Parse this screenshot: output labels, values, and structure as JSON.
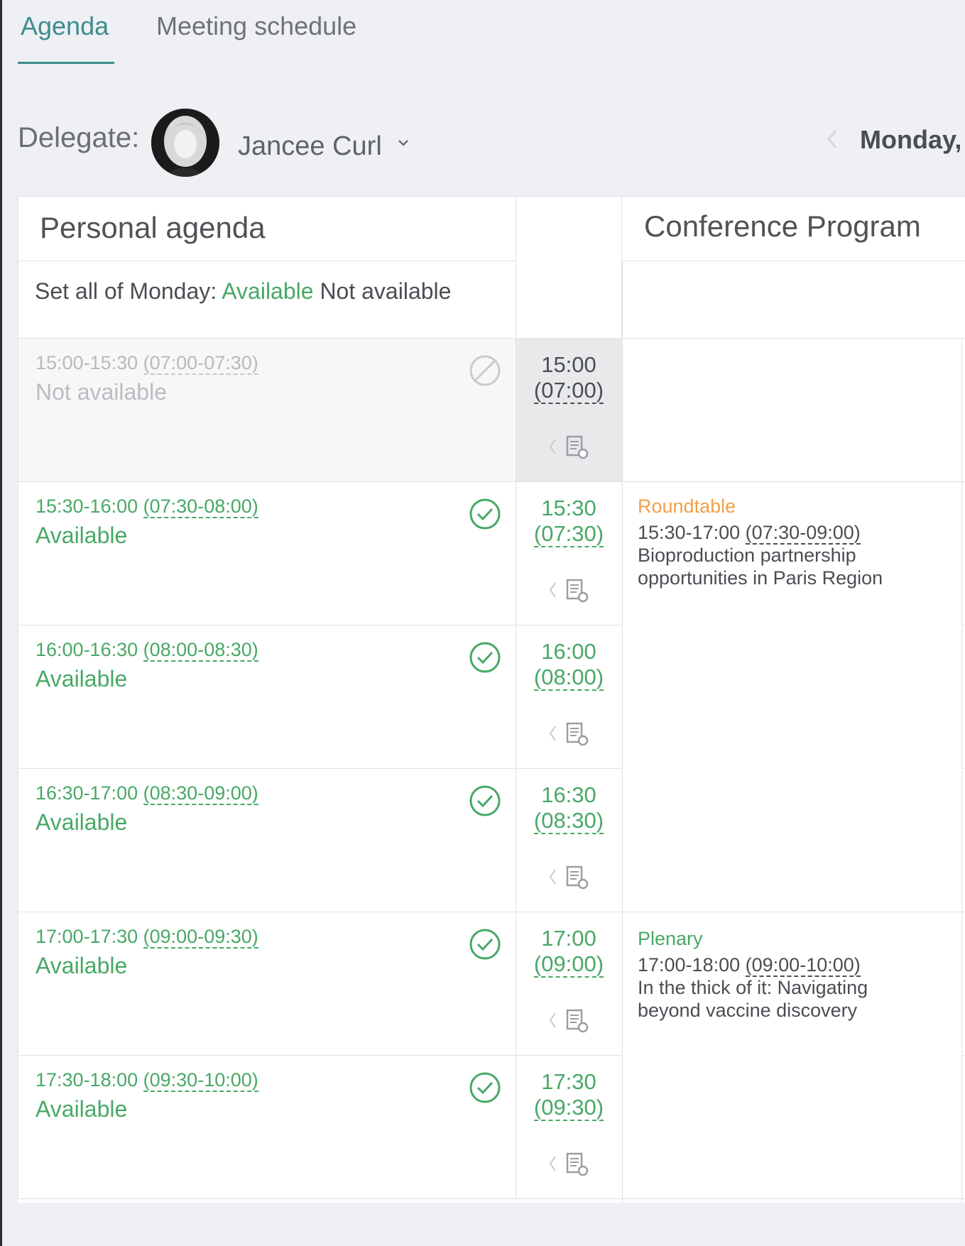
{
  "tabs": [
    {
      "label": "Agenda",
      "active": true
    },
    {
      "label": "Meeting schedule",
      "active": false
    }
  ],
  "delegate": {
    "label": "Delegate:",
    "name": "Jancee Curl"
  },
  "date": {
    "label": "Monday, :"
  },
  "personal_agenda": {
    "title": "Personal agenda",
    "set_all_prefix": "Set all of Monday:",
    "set_available": "Available",
    "set_not_available": "Not available"
  },
  "conference": {
    "title": "Conference Program"
  },
  "slots": [
    {
      "time": "15:00-15:30",
      "local": "(07:00-07:30)",
      "status": "Not available",
      "axis_time": "15:00",
      "axis_local": "(07:00)"
    },
    {
      "time": "15:30-16:00",
      "local": "(07:30-08:00)",
      "status": "Available",
      "axis_time": "15:30",
      "axis_local": "(07:30)"
    },
    {
      "time": "16:00-16:30",
      "local": "(08:00-08:30)",
      "status": "Available",
      "axis_time": "16:00",
      "axis_local": "(08:00)"
    },
    {
      "time": "16:30-17:00",
      "local": "(08:30-09:00)",
      "status": "Available",
      "axis_time": "16:30",
      "axis_local": "(08:30)"
    },
    {
      "time": "17:00-17:30",
      "local": "(09:00-09:30)",
      "status": "Available",
      "axis_time": "17:00",
      "axis_local": "(09:00)"
    },
    {
      "time": "17:30-18:00",
      "local": "(09:30-10:00)",
      "status": "Available",
      "axis_time": "17:30",
      "axis_local": "(09:30)"
    }
  ],
  "sessions": [
    {
      "type": "Roundtable",
      "time": "15:30-17:00",
      "local": "(07:30-09:00)",
      "title": "Bioproduction partnership opportunities in Paris Region"
    },
    {
      "type": "Plenary",
      "time": "17:00-18:00",
      "local": "(09:00-10:00)",
      "title": "In the thick of it: Navigating beyond vaccine discovery"
    }
  ],
  "colors": {
    "accent": "#3e8d8e",
    "available": "#48a866",
    "roundtable": "#f0a04b"
  }
}
